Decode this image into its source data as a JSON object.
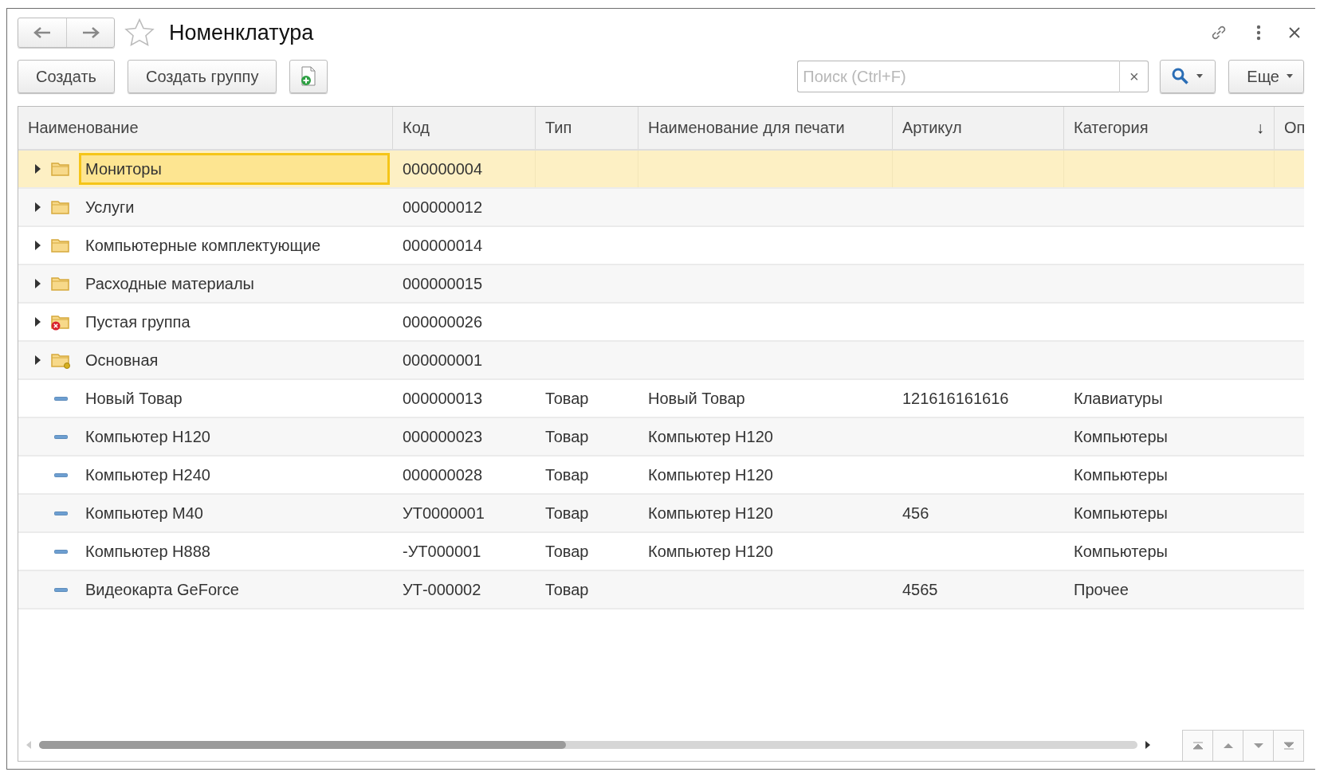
{
  "window": {
    "title": "Номенклатура",
    "favorite": false
  },
  "toolbar": {
    "buttons": [
      "Создать",
      "Создать группу"
    ],
    "search": {
      "placeholder": "Поиск (Ctrl+F)",
      "clear": "×"
    },
    "more": "Еще"
  },
  "table": {
    "columns": [
      {
        "label": "Наименование"
      },
      {
        "label": "Код"
      },
      {
        "label": "Тип"
      },
      {
        "label": "Наименование для печати"
      },
      {
        "label": "Артикул"
      },
      {
        "label": "Категория",
        "sort_mark": "↓"
      },
      {
        "label": "Оп"
      }
    ],
    "rows": [
      {
        "kind": "group",
        "expanded": false,
        "selected": true,
        "cells": [
          "Мониторы",
          "000000004",
          "",
          "",
          "",
          ""
        ]
      },
      {
        "kind": "group",
        "expanded": false,
        "selected": false,
        "cells": [
          "Услуги",
          "000000012",
          "",
          "",
          "",
          ""
        ]
      },
      {
        "kind": "group",
        "expanded": false,
        "selected": false,
        "cells": [
          "Компьютерные комплектующие",
          "000000014",
          "",
          "",
          "",
          ""
        ]
      },
      {
        "kind": "group",
        "expanded": false,
        "selected": false,
        "cells": [
          "Расходные материалы",
          "000000015",
          "",
          "",
          "",
          ""
        ]
      },
      {
        "kind": "deleted_group",
        "expanded": false,
        "selected": false,
        "cells": [
          "Пустая группа",
          "000000026",
          "",
          "",
          "",
          ""
        ]
      },
      {
        "kind": "predefined_group",
        "expanded": false,
        "selected": false,
        "cells": [
          "Основная",
          "000000001",
          "",
          "",
          "",
          ""
        ]
      },
      {
        "kind": "item",
        "selected": false,
        "cells": [
          "Новый Товар",
          "000000013",
          "Товар",
          "Новый Товар",
          "121616161616",
          "Клавиатуры"
        ]
      },
      {
        "kind": "item",
        "selected": false,
        "cells": [
          "Компьютер Н120",
          "000000023",
          "Товар",
          "Компьютер Н120",
          "",
          "Компьютеры"
        ]
      },
      {
        "kind": "item",
        "selected": false,
        "cells": [
          "Компьютер Н240",
          "000000028",
          "Товар",
          "Компьютер Н120",
          "",
          "Компьютеры"
        ]
      },
      {
        "kind": "item",
        "selected": false,
        "cells": [
          "Компьютер М40",
          "УТ0000001",
          "Товар",
          "Компьютер Н120",
          "456",
          "Компьютеры"
        ]
      },
      {
        "kind": "item",
        "selected": false,
        "cells": [
          "Компьютер Н888",
          "-УТ000001",
          "Товар",
          "Компьютер Н120",
          "",
          "Компьютеры"
        ]
      },
      {
        "kind": "item",
        "selected": false,
        "cells": [
          "Видеокарта GeForce",
          "УТ-000002",
          "Товар",
          "",
          "4565",
          "Прочее"
        ]
      }
    ]
  }
}
